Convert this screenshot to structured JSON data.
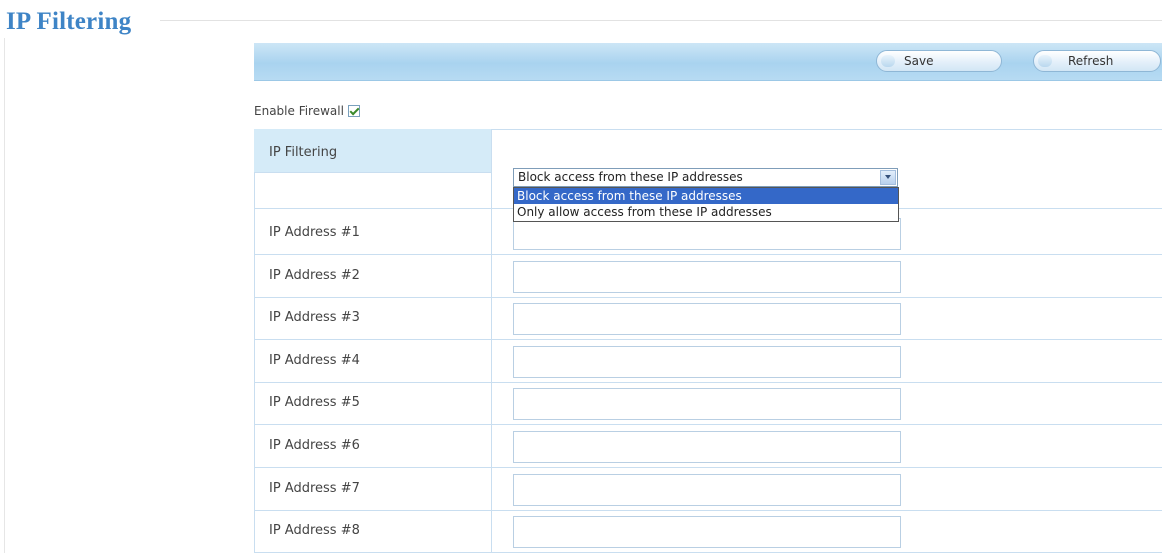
{
  "page": {
    "title": "IP Filtering"
  },
  "toolbar": {
    "save_label": "Save",
    "refresh_label": "Refresh"
  },
  "firewall": {
    "enable_label": "Enable Firewall",
    "enabled": true
  },
  "filter": {
    "label": "IP Filtering",
    "selected": "Block access from these IP addresses",
    "options": [
      "Block access from these IP addresses",
      "Only allow access from these IP addresses"
    ]
  },
  "ip_addresses": [
    {
      "label": "IP Address #1",
      "value": ""
    },
    {
      "label": "IP Address #2",
      "value": ""
    },
    {
      "label": "IP Address #3",
      "value": ""
    },
    {
      "label": "IP Address #4",
      "value": ""
    },
    {
      "label": "IP Address #5",
      "value": ""
    },
    {
      "label": "IP Address #6",
      "value": ""
    },
    {
      "label": "IP Address #7",
      "value": ""
    },
    {
      "label": "IP Address #8",
      "value": ""
    }
  ]
}
